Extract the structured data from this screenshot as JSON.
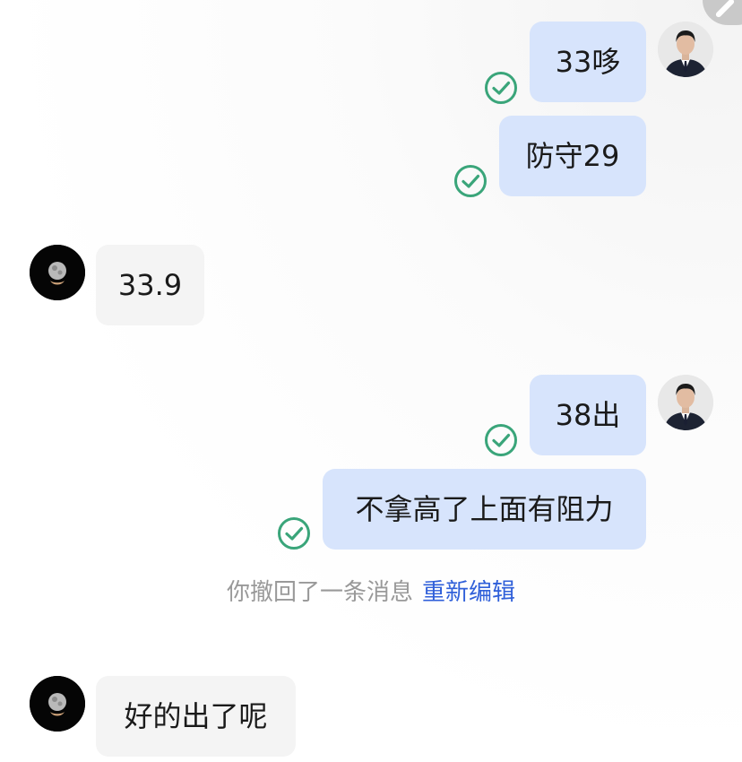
{
  "messages": [
    {
      "side": "out",
      "text": "33哆",
      "status": "read-check-icon"
    },
    {
      "side": "out",
      "text": "防守29",
      "status": "read-check-icon"
    },
    {
      "side": "in",
      "text": "33.9"
    },
    {
      "side": "out",
      "text": "38出",
      "status": "read-check-icon"
    },
    {
      "side": "out",
      "text": "不拿高了上面有阻力",
      "status": "read-check-icon"
    },
    {
      "side": "in",
      "text": "好的出了呢"
    }
  ],
  "system": {
    "recall_text": "你撤回了一条消息",
    "reedit_label": "重新编辑"
  },
  "colors": {
    "outgoing_bubble": "#d7e4fc",
    "incoming_bubble": "#f4f4f4",
    "check": "#3aa57a",
    "link": "#2f5fd9"
  }
}
